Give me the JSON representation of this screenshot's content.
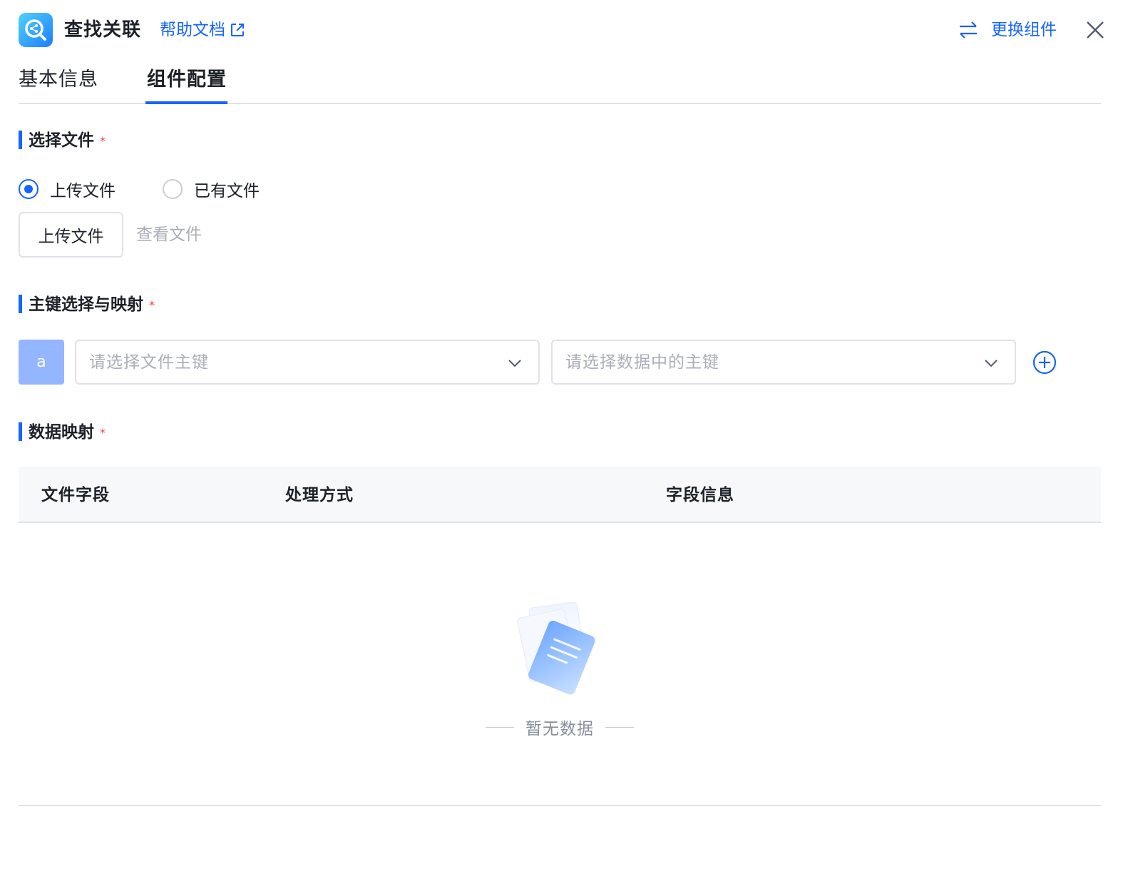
{
  "header": {
    "title": "查找关联",
    "help_label": "帮助文档",
    "switch_label": "更换组件",
    "app_icon": "search-link-icon",
    "colors": {
      "accent": "#1664ff",
      "icon_gradient_start": "#4fd1ff",
      "icon_gradient_end": "#1e7dff"
    }
  },
  "tabs": [
    {
      "label": "基本信息",
      "active": false
    },
    {
      "label": "组件配置",
      "active": true
    }
  ],
  "file_section": {
    "title": "选择文件",
    "required_mark": "*",
    "radios": [
      {
        "label": "上传文件",
        "checked": true
      },
      {
        "label": "已有文件",
        "checked": false
      }
    ],
    "upload_button": "上传文件",
    "view_file_link": "查看文件"
  },
  "key_section": {
    "title": "主键选择与映射",
    "required_mark": "*",
    "badge": "a",
    "file_key_placeholder": "请选择文件主键",
    "data_key_placeholder": "请选择数据中的主键"
  },
  "mapping_section": {
    "title": "数据映射",
    "required_mark": "*",
    "columns": [
      "文件字段",
      "处理方式",
      "字段信息"
    ],
    "rows": [],
    "empty_text": "暂无数据"
  }
}
